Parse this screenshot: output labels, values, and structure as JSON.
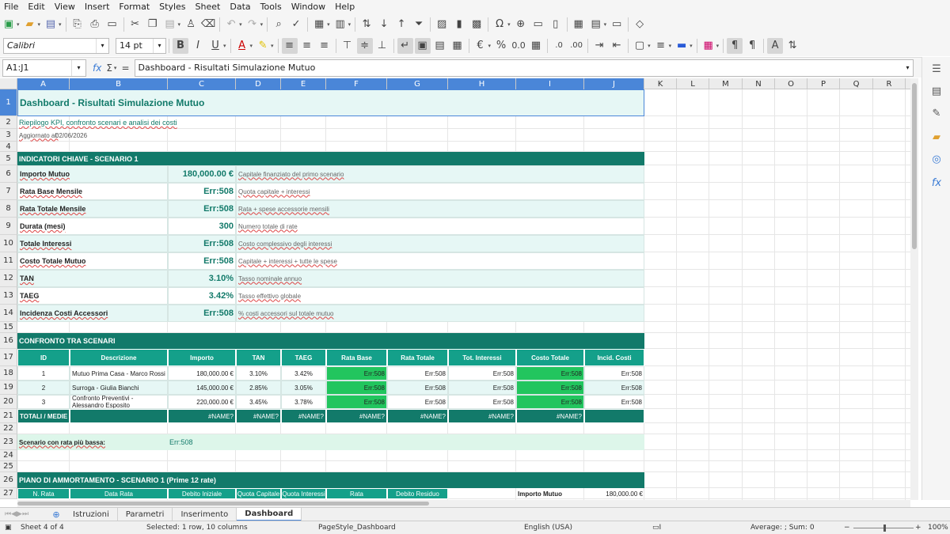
{
  "menu": [
    "File",
    "Edit",
    "View",
    "Insert",
    "Format",
    "Styles",
    "Sheet",
    "Data",
    "Tools",
    "Window",
    "Help"
  ],
  "font": {
    "name": "Calibri",
    "size": "14 pt"
  },
  "namebox": "A1:J1",
  "formula": "Dashboard - Risultati Simulazione Mutuo",
  "columns": [
    "A",
    "B",
    "C",
    "D",
    "E",
    "F",
    "G",
    "H",
    "I",
    "J",
    "K",
    "L",
    "M",
    "N",
    "O",
    "P",
    "Q",
    "R"
  ],
  "rows": [
    "1",
    "2",
    "3",
    "4",
    "5",
    "6",
    "7",
    "8",
    "9",
    "10",
    "11",
    "12",
    "13",
    "14",
    "15",
    "16",
    "17",
    "18",
    "19",
    "20",
    "21",
    "22",
    "23",
    "24",
    "25",
    "26",
    "27"
  ],
  "sheet": {
    "title": "Dashboard - Risultati Simulazione Mutuo",
    "subtitle": "Riepilogo KPI, confronto scenari e analisi dei costi",
    "updated_label": "Aggiornato al:",
    "updated_value": "02/06/2026",
    "kpi_header": "INDICATORI CHIAVE - SCENARIO 1",
    "kpis": [
      {
        "label": "Importo Mutuo",
        "value": "180,000.00 €",
        "note": "Capitale finanziato del primo scenario"
      },
      {
        "label": "Rata Base Mensile",
        "value": "Err:508",
        "note": "Quota capitale + interessi"
      },
      {
        "label": "Rata Totale Mensile",
        "value": "Err:508",
        "note": "Rata + spese accessorie mensili"
      },
      {
        "label": "Durata (mesi)",
        "value": "300",
        "note": "Numero totale di rate"
      },
      {
        "label": "Totale Interessi",
        "value": "Err:508",
        "note": "Costo complessivo degli interessi"
      },
      {
        "label": "Costo Totale Mutuo",
        "value": "Err:508",
        "note": "Capitale + interessi + tutte le spese"
      },
      {
        "label": "TAN",
        "value": "3.10%",
        "note": "Tasso nominale annuo"
      },
      {
        "label": "TAEG",
        "value": "3.42%",
        "note": "Tasso effettivo globale"
      },
      {
        "label": "Incidenza Costi Accessori",
        "value": "Err:508",
        "note": "% costi accessori sul totale mutuo"
      }
    ],
    "compare_header": "CONFRONTO TRA SCENARI",
    "table_headers": [
      "ID",
      "Descrizione",
      "Importo",
      "TAN",
      "TAEG",
      "Rata Base",
      "Rata Totale",
      "Tot. Interessi",
      "Costo Totale",
      "Incid. Costi"
    ],
    "scenarios": [
      [
        "1",
        "Mutuo Prima Casa - Marco Rossi",
        "180,000.00 €",
        "3.10%",
        "3.42%",
        "Err:508",
        "Err:508",
        "Err:508",
        "Err:508",
        "Err:508"
      ],
      [
        "2",
        "Surroga - Giulia Bianchi",
        "145,000.00 €",
        "2.85%",
        "3.05%",
        "Err:508",
        "Err:508",
        "Err:508",
        "Err:508",
        "Err:508"
      ],
      [
        "3",
        "Confronto Preventivi - Alessandro Esposito",
        "220,000.00 €",
        "3.45%",
        "3.78%",
        "Err:508",
        "Err:508",
        "Err:508",
        "Err:508",
        "Err:508"
      ]
    ],
    "totals": [
      "TOTALI / MEDIE",
      "",
      "#NAME?",
      "#NAME?",
      "#NAME?",
      "#NAME?",
      "#NAME?",
      "#NAME?",
      "#NAME?",
      ""
    ],
    "lowest_label": "Scenario con rata più bassa:",
    "lowest_value": "Err:508",
    "amort_header": "PIANO DI AMMORTAMENTO - SCENARIO 1 (Prime 12 rate)",
    "amort_cols": [
      "N. Rata",
      "Data Rata",
      "Debito Iniziale",
      "Quota Capitale",
      "Quota Interessi",
      "Rata",
      "Debito Residuo"
    ],
    "side_label": "Importo Mutuo",
    "side_value": "180,000.00 €"
  },
  "tabs": [
    "Istruzioni",
    "Parametri",
    "Inserimento",
    "Dashboard"
  ],
  "status": {
    "sheet": "Sheet 4 of 4",
    "selection": "Selected: 1 row, 10 columns",
    "pagestyle": "PageStyle_Dashboard",
    "lang": "English (USA)",
    "sum": "Average: ; Sum: 0",
    "zoom": "100%"
  },
  "colors": {
    "teal": "#127a6a",
    "light": "#e6f7f5",
    "green": "#22c55e",
    "accent": "#4a86d8"
  }
}
